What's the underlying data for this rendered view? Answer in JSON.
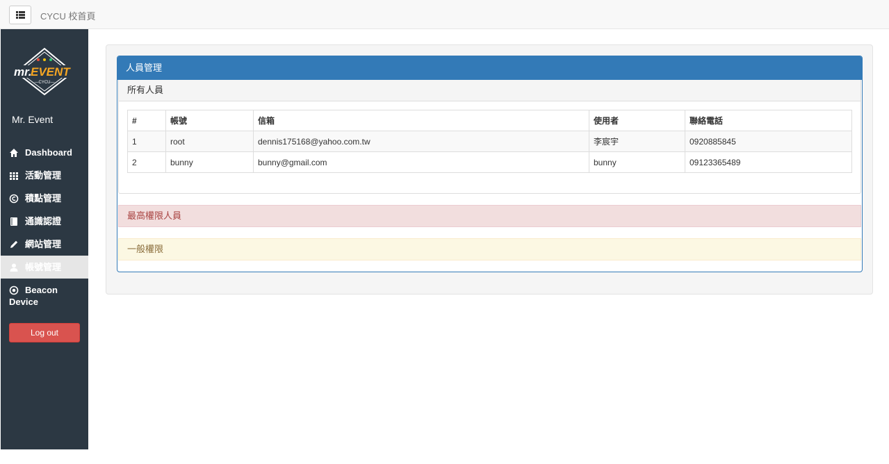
{
  "topbar": {
    "title": "CYCU 校首頁",
    "toggle_icon": "list-icon"
  },
  "sidebar": {
    "brand": "Mr. Event",
    "logo_text": "mr.EVENT",
    "logo_sub": "—CYCU—",
    "items": [
      {
        "label": "Dashboard",
        "icon": "home-icon"
      },
      {
        "label": "活動管理",
        "icon": "grid-icon"
      },
      {
        "label": "積點管理",
        "icon": "copyright-icon"
      },
      {
        "label": "通識認證",
        "icon": "book-icon"
      },
      {
        "label": "網站管理",
        "icon": "pencil-icon"
      },
      {
        "label": "帳號管理",
        "icon": "user-icon",
        "active": true
      },
      {
        "label_line1": "Beacon",
        "label_line2": "Device",
        "icon": "record-icon"
      }
    ],
    "logout_label": "Log out"
  },
  "main": {
    "panel_title": "人員管理",
    "all_members": {
      "title": "所有人員",
      "columns": [
        "#",
        "帳號",
        "信箱",
        "使用者",
        "聯絡電話"
      ],
      "rows": [
        [
          "1",
          "root",
          "dennis175168@yahoo.com.tw",
          "李宸宇",
          "0920885845"
        ],
        [
          "2",
          "bunny",
          "bunny@gmail.com",
          "bunny",
          "09123365489"
        ]
      ]
    },
    "admin_panel_title": "最高權限人員",
    "general_panel_title": "一般權限"
  },
  "colors": {
    "sidebar_bg": "#2c3843",
    "primary": "#337ab7",
    "danger": "#d9534f"
  }
}
